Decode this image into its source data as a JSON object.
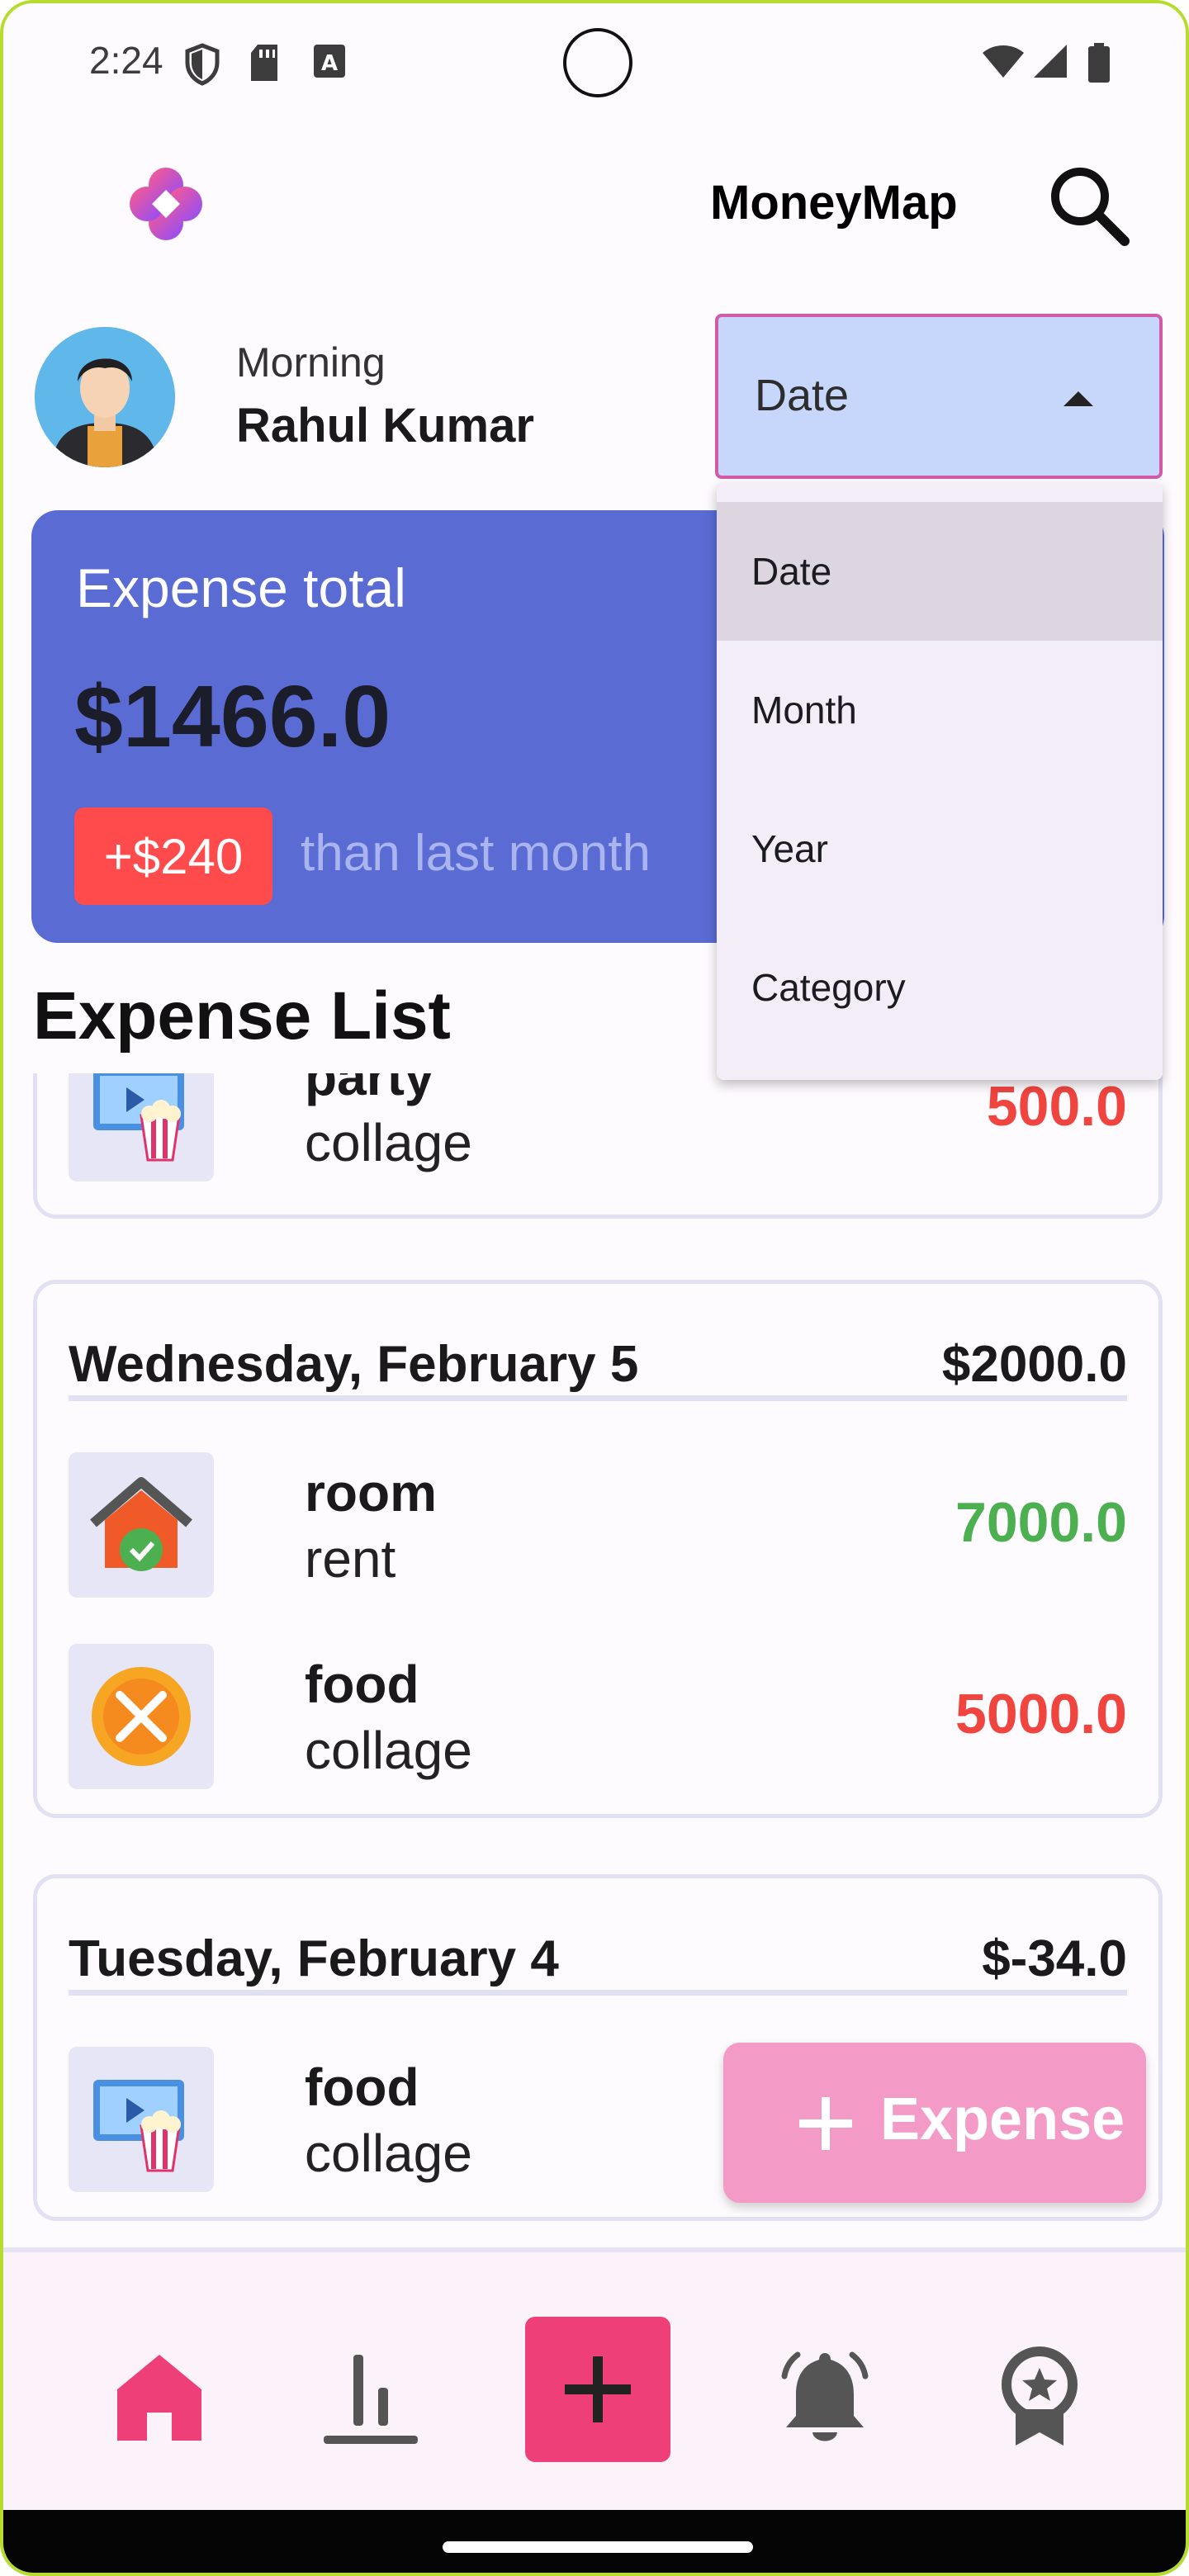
{
  "status_bar": {
    "time": "2:24",
    "icons": [
      "shield-icon",
      "sd-card-icon",
      "text-a-icon",
      "wifi-icon",
      "signal-icon",
      "battery-icon"
    ]
  },
  "app_bar": {
    "title": "MoneyMap",
    "logo_icon": "app-logo-icon",
    "search_icon": "search-icon"
  },
  "profile": {
    "greeting": "Morning",
    "name": "Rahul Kumar"
  },
  "filter_dropdown": {
    "selected": "Date",
    "options": [
      "Date",
      "Month",
      "Year",
      "Category"
    ]
  },
  "summary": {
    "label": "Expense total",
    "amount": "$1466.0",
    "change_badge": "+$240",
    "change_note": "than last month",
    "colors": {
      "card": "#5a6bd3",
      "badge": "#ff4b4b"
    }
  },
  "expense_list": {
    "title": "Expense List",
    "partial_first": {
      "title": "party",
      "subtitle": "collage",
      "amount": "500.0",
      "icon": "movie-popcorn-icon"
    },
    "days": [
      {
        "date": "Wednesday, February 5",
        "total": "$2000.0",
        "items": [
          {
            "title": "room",
            "subtitle": "rent",
            "amount": "7000.0",
            "type": "income",
            "icon": "house-icon"
          },
          {
            "title": "food",
            "subtitle": "collage",
            "amount": "5000.0",
            "type": "expense",
            "icon": "food-fork-knife-icon"
          }
        ]
      },
      {
        "date": "Tuesday, February 4",
        "total": "$-34.0",
        "items": [
          {
            "title": "food",
            "subtitle": "collage",
            "amount": "",
            "type": "expense",
            "icon": "movie-popcorn-icon"
          }
        ]
      }
    ],
    "colors": {
      "expense": "#f0443f",
      "income": "#4caf50"
    }
  },
  "fab": {
    "label": "Expense",
    "icon": "plus-icon",
    "color": "#f39bc6"
  },
  "bottom_nav": {
    "items": [
      "home-icon",
      "stats-icon",
      "add-icon",
      "bell-icon",
      "award-icon"
    ],
    "active": "home-icon",
    "accent": "#ee3f79"
  }
}
